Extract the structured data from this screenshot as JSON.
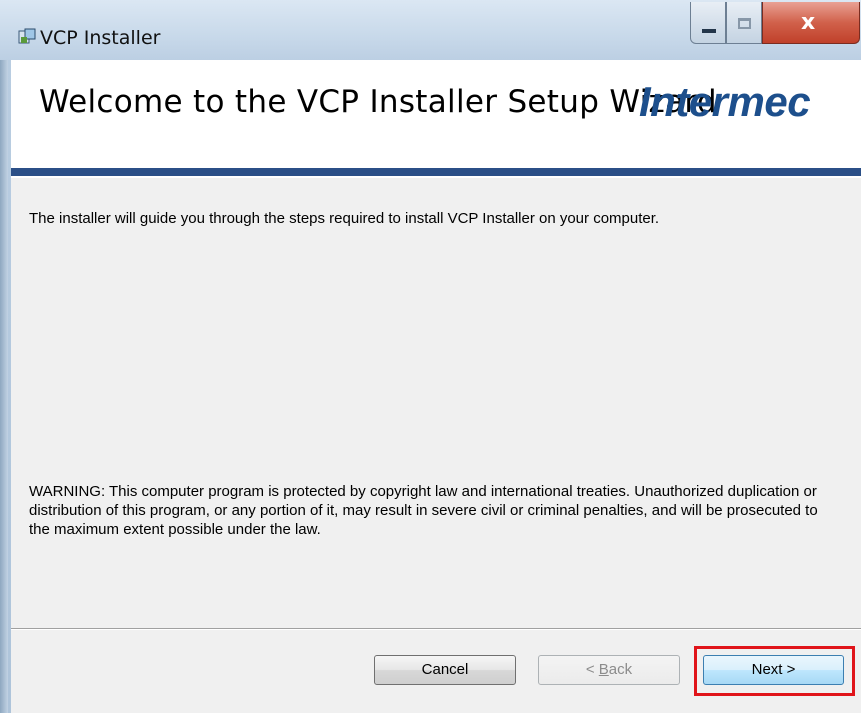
{
  "window": {
    "title": "VCP Installer",
    "close_glyph": "x"
  },
  "banner": {
    "title": "Welcome to the VCP Installer Setup Wizard",
    "brand": "Intermec"
  },
  "body": {
    "intro": "The installer will guide you through the steps required to install VCP Installer on your computer.",
    "warning": "WARNING: This computer program is protected by copyright law and international treaties. Unauthorized duplication or distribution of this program, or any portion of it, may result in severe civil or criminal penalties, and will be prosecuted to the maximum extent possible under the law."
  },
  "buttons": {
    "cancel": "Cancel",
    "back_prefix": "< ",
    "back_mnemonic": "B",
    "back_rest": "ack",
    "next": "Next >"
  },
  "colors": {
    "banner_rule": "#2b4f87",
    "brand": "#1d4f8c",
    "highlight": "#e0141a"
  }
}
